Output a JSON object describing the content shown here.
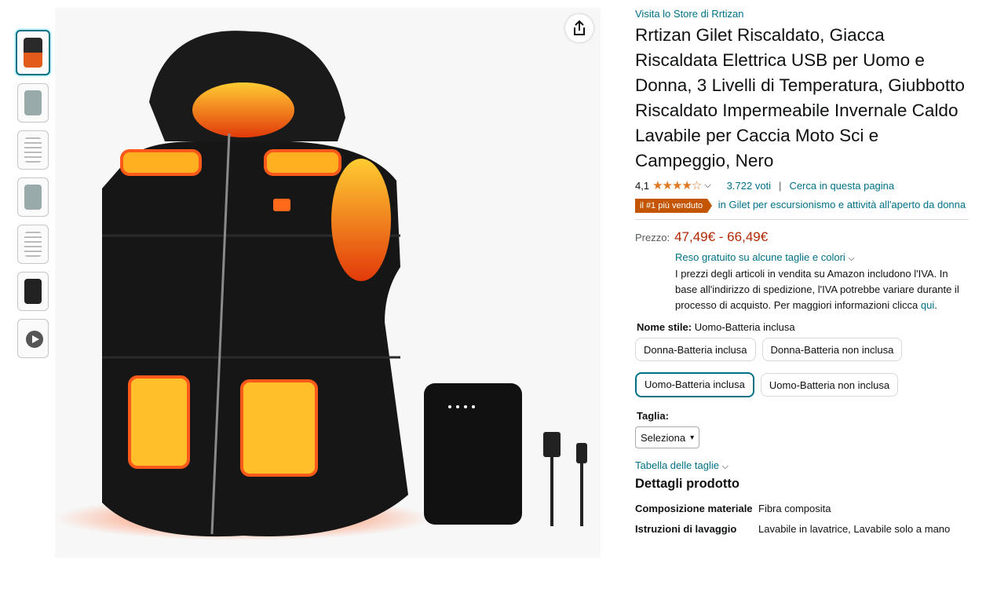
{
  "store_link": "Visita lo Store di Rrtizan",
  "title": "Rrtizan Gilet Riscaldato, Giacca Riscaldata Elettrica USB per Uomo e Donna, 3 Livelli di Temperatura, Giubbotto Riscaldato Impermeabile Invernale Caldo Lavabile per Caccia Moto Sci e Campeggio, Nero",
  "rating": {
    "value": "4,1",
    "stars": "★★★★☆",
    "votes": "3.722 voti",
    "search": "Cerca in questa pagina"
  },
  "bestseller": {
    "badge": "il #1 più venduto",
    "category": "in Gilet per escursionismo e attività all'aperto da donna"
  },
  "price": {
    "label": "Prezzo:",
    "value": "47,49€ - 66,49€"
  },
  "returns": "Reso gratuito su alcune taglie e colori",
  "vat_note": "I prezzi degli articoli in vendita su Amazon includono l'IVA. In base all'indirizzo di spedizione, l'IVA potrebbe variare durante il processo di acquisto. Per maggiori informazioni clicca",
  "vat_link": "qui",
  "style": {
    "label": "Nome stile:",
    "selected": "Uomo-Batteria inclusa",
    "options": [
      "Donna-Batteria inclusa",
      "Donna-Batteria non inclusa",
      "Uomo-Batteria inclusa",
      "Uomo-Batteria non inclusa"
    ]
  },
  "size": {
    "label": "Taglia:",
    "select": "Seleziona",
    "chart_link": "Tabella delle taglie"
  },
  "details": {
    "heading": "Dettagli prodotto",
    "rows": [
      {
        "k": "Composizione materiale",
        "v": "Fibra composita"
      },
      {
        "k": "Istruzioni di lavaggio",
        "v": "Lavabile in lavatrice, Lavabile solo a mano"
      }
    ]
  },
  "colors": {
    "link": "#007185",
    "price": "#b12704",
    "badge": "#c45500",
    "star": "#de7921"
  }
}
